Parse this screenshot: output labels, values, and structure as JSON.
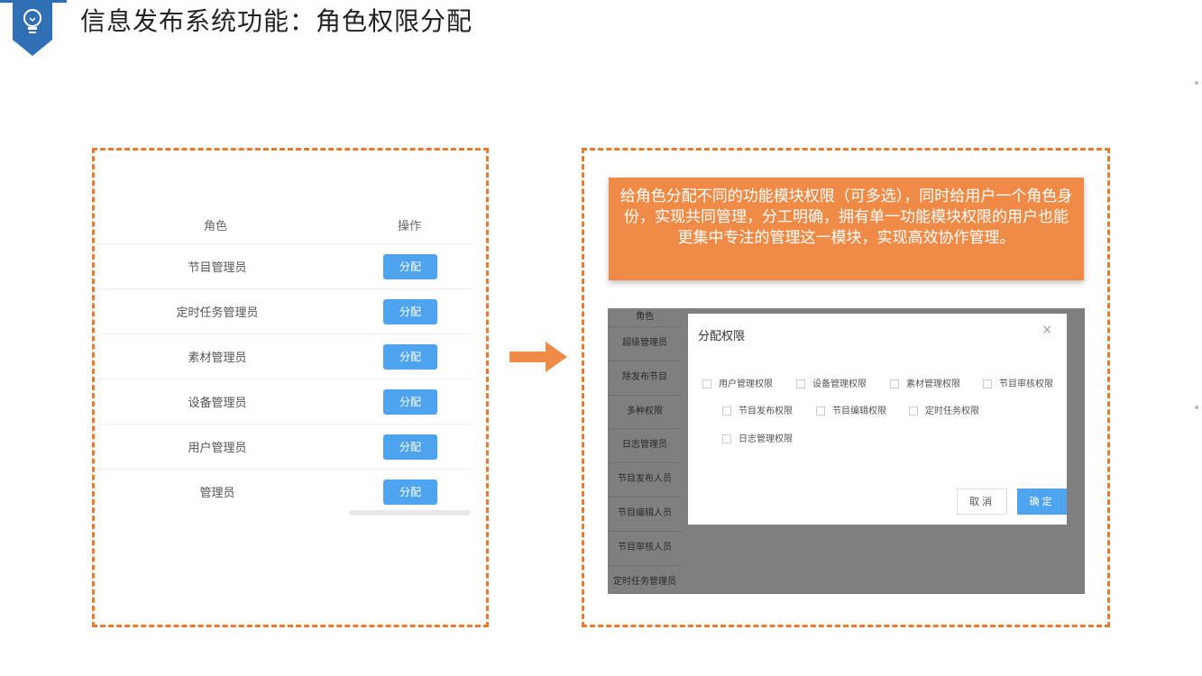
{
  "header": {
    "title": "信息发布系统功能：角色权限分配",
    "icon": "lightbulb-icon",
    "accent": "#2f6fb5"
  },
  "role_table": {
    "col_role": "角色",
    "col_action": "操作",
    "rows": [
      {
        "name": "节目管理员",
        "action": "分配"
      },
      {
        "name": "定时任务管理员",
        "action": "分配"
      },
      {
        "name": "素材管理员",
        "action": "分配"
      },
      {
        "name": "设备管理员",
        "action": "分配"
      },
      {
        "name": "用户管理员",
        "action": "分配"
      },
      {
        "name": "管理员",
        "action": "分配"
      }
    ]
  },
  "callout": {
    "text": "给角色分配不同的功能模块权限（可多选），同时给用户一个角色身份，实现共同管理，分工明确，拥有单一功能模块权限的用户也能更集中专注的管理这一模块，实现高效协作管理。"
  },
  "screenshot": {
    "list_header": "角色",
    "list_items": [
      "超级管理员",
      "除发布节目",
      "多种权限",
      "日志管理员",
      "节目发布人员",
      "节目编辑人员",
      "节目审核人员",
      "定时任务管理员"
    ],
    "modal": {
      "title": "分配权限",
      "close": "×",
      "permissions": [
        "用户管理权限",
        "设备管理权限",
        "素材管理权限",
        "节目审核权限",
        "节目发布权限",
        "节目编辑权限",
        "定时任务权限",
        "日志管理权限"
      ],
      "cancel_label": "取消",
      "ok_label": "确定"
    }
  },
  "colors": {
    "orange": "#e87b2f",
    "button_blue": "#4fa4ef"
  }
}
